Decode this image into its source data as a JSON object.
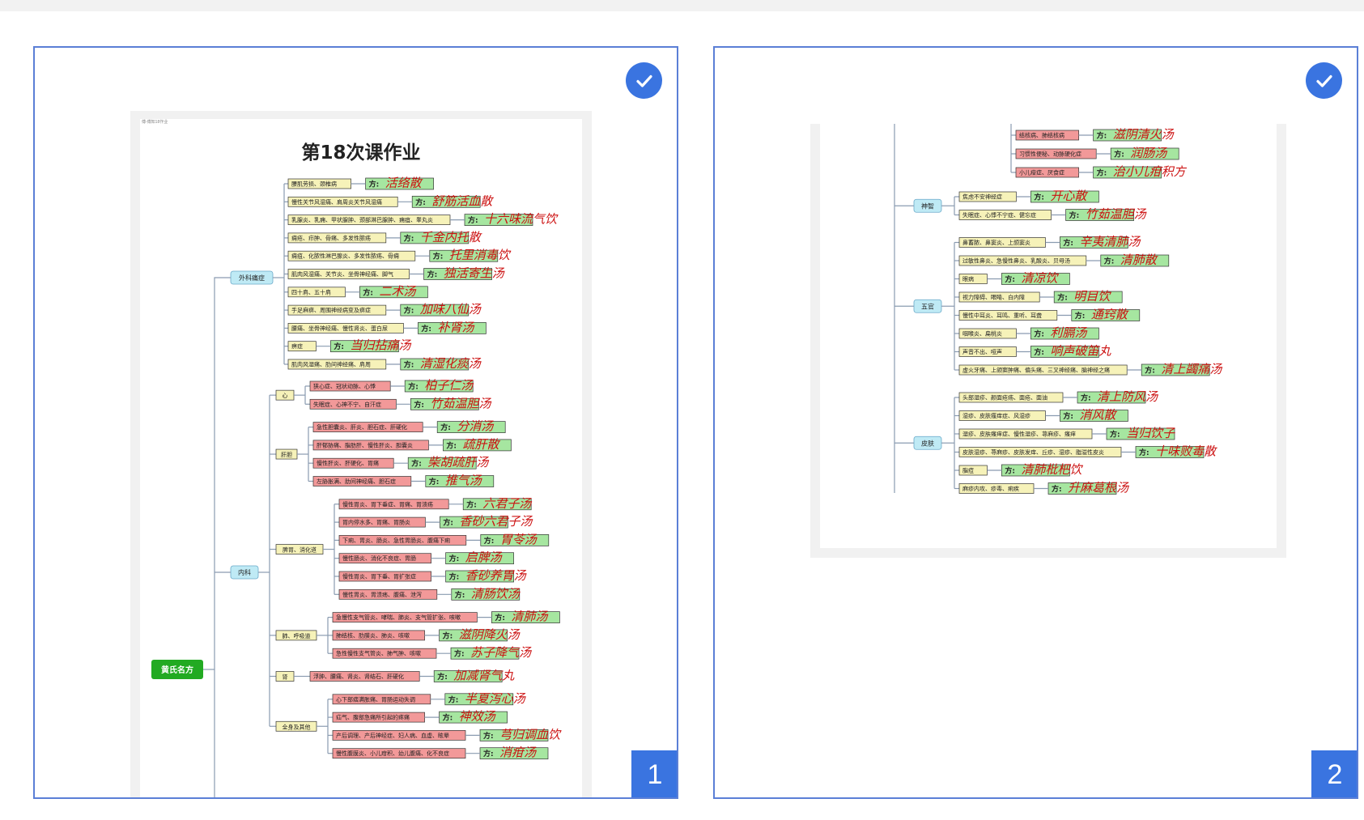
{
  "colors": {
    "accent": "#3a74e0",
    "card_border": "#5b7fd6",
    "root_green": "#22aa22",
    "category_cyan": "#bfeaf5",
    "symptom_yellow": "#f6f2b9",
    "symptom_red": "#f29999",
    "fang_green": "#a6e6a0",
    "ink_red": "#cc1111"
  },
  "icons": {
    "selected": "check-circle-icon"
  },
  "cards": [
    {
      "index_label": "1",
      "selected": true,
      "tiny_caption": "傅-傅知18作业",
      "doc_title": "第18次课作业",
      "root_label": "黄氏名方",
      "fang_prefix": "方:",
      "categories": [
        {
          "label": "外科痛症",
          "items": [
            {
              "text": "腰肌劳损、颈椎病",
              "hand": "活络散"
            },
            {
              "text": "慢性关节风湿痛、肩周炎关节风湿痛",
              "hand": "舒筋活血散"
            },
            {
              "text": "乳腺炎、乳痈、甲状腺肿、颈部淋巴腺肿、痈疽、睾丸炎",
              "hand": "十六味流气饮"
            },
            {
              "text": "痈疮、疖肿、骨痛、多发性脓疡",
              "hand": "千金内托散"
            },
            {
              "text": "痈疽、化脓性淋巴腺炎、多发性脓疡、骨痈",
              "hand": "托里消毒饮"
            },
            {
              "text": "肌肉风湿痛、关节炎、坐骨神经痛、脚气",
              "hand": "独活寄生汤"
            },
            {
              "text": "四十肩、五十肩",
              "hand": "二术汤"
            },
            {
              "text": "手足麻痹、周围神经病变及痹症",
              "hand": "加味八仙汤"
            },
            {
              "text": "腰痛、坐骨神经痛、慢性肾炎、蛋白尿",
              "hand": "补肾汤"
            },
            {
              "text": "痹症",
              "hand": "当归拈痛汤"
            },
            {
              "text": "肌肉风湿痛、肋间神经痛、肩周",
              "hand": "清湿化痰汤"
            }
          ]
        },
        {
          "label": "内科",
          "subs": [
            {
              "label": "心",
              "items": [
                {
                  "text": "狭心症、冠状动脉、心悸",
                  "hand": "柏子仁汤"
                },
                {
                  "text": "失眠症、心神不宁、自汗症",
                  "hand": "竹茹温胆汤"
                }
              ]
            },
            {
              "label": "肝胆",
              "items": [
                {
                  "text": "急性胆囊炎、肝炎、胆石症、肝硬化",
                  "hand": "分消汤"
                },
                {
                  "text": "肝郁胁痛、脂肪肝、慢性肝炎、胆囊炎",
                  "hand": "疏肝散"
                },
                {
                  "text": "慢性肝炎、肝硬化、胃痛",
                  "hand": "柴胡疏肝汤"
                },
                {
                  "text": "左胁胀满、肋间神经痛、胆石症",
                  "hand": "推气汤"
                }
              ]
            },
            {
              "label": "脾胃、消化道",
              "items": [
                {
                  "text": "慢性胃炎、胃下垂症、胃痛、胃溃疡",
                  "hand": "六君子汤"
                },
                {
                  "text": "胃内停水多、胃痛、胃肠炎",
                  "hand": "香砂六君子汤"
                },
                {
                  "text": "下痢、胃炎、肠炎、急性胃肠炎、腹痛下痢",
                  "hand": "胃苓汤"
                },
                {
                  "text": "慢性肠炎、消化不良症、胃肠",
                  "hand": "启脾汤"
                },
                {
                  "text": "慢性胃炎、胃下垂、胃扩张症",
                  "hand": "香砂养胃汤"
                },
                {
                  "text": "慢性胃炎、胃溃疡、腹痛、泄泻",
                  "hand": "清肠饮汤"
                }
              ]
            },
            {
              "label": "肺、呼吸道",
              "items": [
                {
                  "text": "急慢性支气管炎、哮喘、肺炎、支气管扩张、咳嗽",
                  "hand": "清肺汤"
                },
                {
                  "text": "肺结核、肋膜炎、肺炎、咳嗽",
                  "hand": "滋阴降火汤"
                },
                {
                  "text": "急性慢性支气管炎、肺气肿、咳嗽",
                  "hand": "苏子降气汤"
                }
              ]
            },
            {
              "label": "肾",
              "items": [
                {
                  "text": "浮肿、腰痛、肾炎、肾结石、肝硬化",
                  "hand": "加减肾气丸"
                }
              ]
            },
            {
              "label": "全身及其他",
              "items": [
                {
                  "text": "心下部痞满胀痛、胃肠运动失调",
                  "hand": "半夏泻心汤"
                },
                {
                  "text": "疝气、腹部急痛所引起的疼痛",
                  "hand": "神效汤"
                },
                {
                  "text": "产后调理、产后神经症、妇人病、血虚、眩晕",
                  "hand": "芎归调血饮"
                },
                {
                  "text": "慢性腹膜炎、小儿疳积、幼儿腹痛、化不良症",
                  "hand": "消疳汤"
                }
              ]
            }
          ]
        }
      ]
    },
    {
      "index_label": "2",
      "selected": true,
      "fang_prefix": "方:",
      "top_items": [
        {
          "text": "结核病、肺结核病",
          "hand": "滋阴清火汤"
        },
        {
          "text": "习惯性便秘、动脉硬化症",
          "hand": "润肠汤"
        },
        {
          "text": "小儿疳症、厌食症",
          "hand": "治小儿疳积方"
        }
      ],
      "categories": [
        {
          "label": "神智",
          "items": [
            {
              "text": "焦虑不安神经症",
              "hand": "开心散"
            },
            {
              "text": "失眠症、心悸不宁症、健忘症",
              "hand": "竹茹温胆汤"
            }
          ]
        },
        {
          "label": "五官",
          "items": [
            {
              "text": "鼻蓄脓、鼻窦炎、上颌窦炎",
              "hand": "辛夷清肺汤"
            },
            {
              "text": "过敏性鼻炎、急慢性鼻炎、乳酸炎、贝母汤",
              "hand": "清肺散"
            },
            {
              "text": "眼病",
              "hand": "清凉饮"
            },
            {
              "text": "视力障碍、眼睛、白内障",
              "hand": "明目饮"
            },
            {
              "text": "慢性中耳炎、耳鸣、重听、耳聋",
              "hand": "通窍散"
            },
            {
              "text": "咽喉炎、扁桃炎",
              "hand": "利膈汤"
            },
            {
              "text": "声音不出、哑声",
              "hand": "响声破笛丸"
            },
            {
              "text": "虚火牙痛、上颌窦肿痛、偏头痛、三叉神经痛、脑神经之痛",
              "hand": "清上蠲痛汤"
            }
          ]
        },
        {
          "label": "皮肤",
          "items": [
            {
              "text": "头部湿疹、颜面疮疡、面疮、面油",
              "hand": "清上防风汤"
            },
            {
              "text": "湿疹、皮肤瘙痒症、风湿疹",
              "hand": "消风散"
            },
            {
              "text": "湿疹、皮肤瘙痒症、慢性湿疹、荨麻疹、瘙痒",
              "hand": "当归饮子"
            },
            {
              "text": "皮肤湿疹、荨麻疹、皮肤发痒、丘疹、湿疹、脂溢性皮炎",
              "hand": "十味败毒散"
            },
            {
              "text": "脂痘",
              "hand": "清肺枇杷饮"
            },
            {
              "text": "麻疹内攻、疹毒、痢疾",
              "hand": "升麻葛根汤"
            }
          ]
        }
      ]
    }
  ]
}
